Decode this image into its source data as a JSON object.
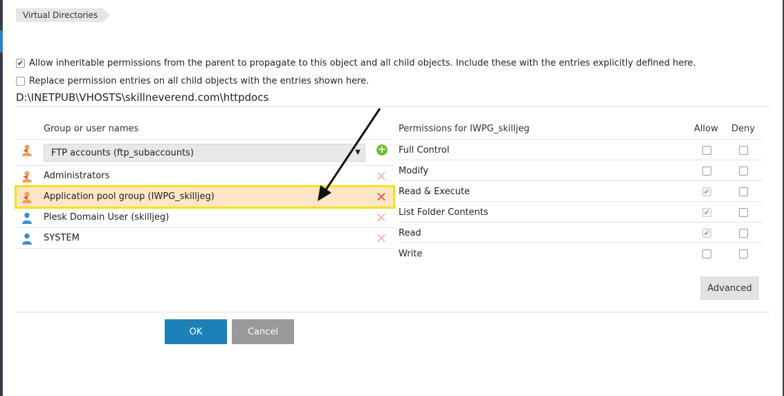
{
  "breadcrumb": {
    "item": "Virtual Directories"
  },
  "options": {
    "inherit": {
      "label": "Allow inheritable permissions from the parent to propagate to this object and all child objects. Include these with the entries explicitly defined here.",
      "checked": true
    },
    "replace": {
      "label": "Replace permission entries on all child objects with the entries shown here.",
      "checked": false
    }
  },
  "path": "D:\\INETPUB\\VHOSTS\\skillneverend.com\\httpdocs",
  "users": {
    "header": "Group or user names",
    "dropdown": {
      "selected": "FTP accounts (ftp_subaccounts)",
      "arrow": "▼"
    },
    "add_icon": "plus-circle-icon",
    "remove_glyph": "✕",
    "items": [
      {
        "name": "Administrators",
        "type": "group",
        "selected": false
      },
      {
        "name": "Application pool group (IWPG_skilljeg)",
        "type": "group",
        "selected": true
      },
      {
        "name": "Plesk Domain User (skilljeg)",
        "type": "user",
        "selected": false
      },
      {
        "name": "SYSTEM",
        "type": "user",
        "selected": false
      }
    ]
  },
  "permissions": {
    "header": "Permissions for IWPG_skilljeg",
    "allow_label": "Allow",
    "deny_label": "Deny",
    "rows": [
      {
        "name": "Full Control",
        "allow": false,
        "allow_disabled": false,
        "deny": false
      },
      {
        "name": "Modify",
        "allow": false,
        "allow_disabled": false,
        "deny": false
      },
      {
        "name": "Read & Execute",
        "allow": true,
        "allow_disabled": true,
        "deny": false
      },
      {
        "name": "List Folder Contents",
        "allow": true,
        "allow_disabled": true,
        "deny": false
      },
      {
        "name": "Read",
        "allow": true,
        "allow_disabled": true,
        "deny": false
      },
      {
        "name": "Write",
        "allow": false,
        "allow_disabled": false,
        "deny": false
      }
    ],
    "advanced_label": "Advanced"
  },
  "buttons": {
    "ok": "OK",
    "cancel": "Cancel"
  },
  "colors": {
    "primary": "#1c81b8",
    "cancel": "#999999",
    "selected_row": "#fde5c5",
    "highlight_outline": "#f5e021",
    "remove_active": "#e86060",
    "add_green": "#6fbe2c"
  }
}
